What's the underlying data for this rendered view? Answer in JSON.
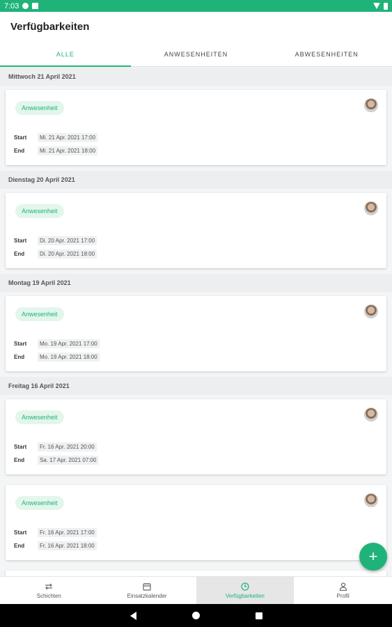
{
  "status_bar": {
    "time": "7:03"
  },
  "app_bar": {
    "title": "Verfügbarkeiten"
  },
  "tabs": [
    {
      "label": "ALLE",
      "active": true
    },
    {
      "label": "ANWESENHEITEN",
      "active": false
    },
    {
      "label": "ABWESENHEITEN",
      "active": false
    }
  ],
  "labels": {
    "start": "Start",
    "end": "End"
  },
  "groups": [
    {
      "date": "Mittwoch 21 April 2021",
      "entries": [
        {
          "type": "Anwesenheit",
          "start": "Mi. 21 Apr. 2021 17:00",
          "end": "Mi. 21 Apr. 2021 18:00"
        }
      ]
    },
    {
      "date": "Dienstag 20 April 2021",
      "entries": [
        {
          "type": "Anwesenheit",
          "start": "Di. 20 Apr. 2021 17:00",
          "end": "Di. 20 Apr. 2021 18:00"
        }
      ]
    },
    {
      "date": "Montag 19 April 2021",
      "entries": [
        {
          "type": "Anwesenheit",
          "start": "Mo. 19 Apr. 2021 17:00",
          "end": "Mo. 19 Apr. 2021 18:00"
        }
      ]
    },
    {
      "date": "Freitag 16 April 2021",
      "entries": [
        {
          "type": "Anwesenheit",
          "start": "Fr. 16 Apr. 2021 20:00",
          "end": "Sa. 17 Apr. 2021 07:00"
        },
        {
          "type": "Anwesenheit",
          "start": "Fr. 16 Apr. 2021 17:00",
          "end": "Fr. 16 Apr. 2021 18:00"
        }
      ]
    }
  ],
  "fab": {
    "icon": "plus-icon",
    "label": "+"
  },
  "bottom_nav": [
    {
      "label": "Schichten",
      "icon": "swap-arrows-icon",
      "active": false
    },
    {
      "label": "Einsatzkalender",
      "icon": "calendar-icon",
      "active": false
    },
    {
      "label": "Verfügbarkeiten",
      "icon": "clock-icon",
      "active": true
    },
    {
      "label": "Profil",
      "icon": "person-icon",
      "active": false
    }
  ],
  "colors": {
    "accent": "#1fb37a",
    "chip_bg": "#e3f6ec",
    "header_bg": "#eceef0"
  }
}
